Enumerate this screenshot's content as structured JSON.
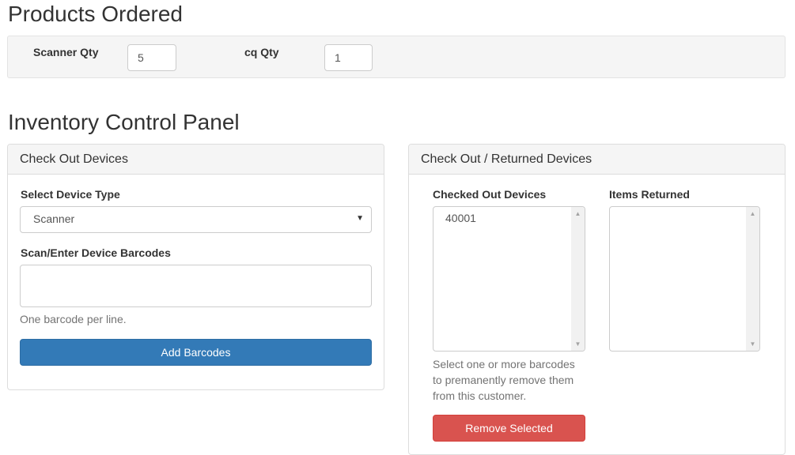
{
  "products_ordered": {
    "title": "Products Ordered",
    "fields": [
      {
        "label": "Scanner Qty",
        "value": "5"
      },
      {
        "label": "cq Qty",
        "value": "1"
      }
    ]
  },
  "inventory": {
    "title": "Inventory Control Panel",
    "checkout_panel": {
      "heading": "Check Out Devices",
      "device_type_label": "Select Device Type",
      "device_type_selected": "Scanner",
      "barcodes_label": "Scan/Enter Device Barcodes",
      "barcodes_value": "",
      "help": "One barcode per line.",
      "add_button": "Add Barcodes"
    },
    "returned_panel": {
      "heading": "Check Out / Returned Devices",
      "checked_out_label": "Checked Out Devices",
      "checked_out_items": [
        "40001"
      ],
      "returned_label": "Items Returned",
      "returned_items": [],
      "help_lines": [
        "Select one or more barcodes",
        "to premanently remove them",
        "from this customer."
      ],
      "remove_button": "Remove Selected"
    }
  },
  "icons": {
    "select_arrow": "caret-down-icon",
    "scroll_up": "scroll-up-arrow-icon",
    "scroll_down": "scroll-down-arrow-icon"
  },
  "colors": {
    "primary": "#337ab7",
    "danger": "#d9534f",
    "panel_heading": "#f5f5f5"
  }
}
